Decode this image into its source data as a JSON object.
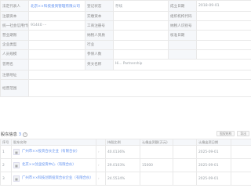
{
  "info_rows": [
    {
      "l1": "法定代表人",
      "v1": "北京××科技投资管理有限公司",
      "l2": "登记状态",
      "v2": "存续",
      "l3": "成立日期",
      "v3": "2018-09-01"
    },
    {
      "l1": "注册资本",
      "v1": "",
      "l2": "实缴资本",
      "v2": "",
      "l3": "组织机构代码",
      "v3": ""
    },
    {
      "l1": "统一社会信用代码",
      "v1": "91440 ···",
      "l2": "工商注册号",
      "v2": "",
      "l3": "纳税人识别号",
      "v3": ""
    },
    {
      "l1": "营业期限",
      "v1": "",
      "l2": "纳税人资质",
      "v2": "",
      "l3": "核准日期",
      "v3": ""
    },
    {
      "l1": "企业类型",
      "v1": "",
      "l2": "行业",
      "v2": "",
      "l3": "",
      "v3": ""
    },
    {
      "l1": "人员规模",
      "v1": "",
      "l2": "参保人数",
      "v2": "",
      "l3": "",
      "v3": ""
    },
    {
      "l1": "曾用名",
      "v1": "",
      "l2": "英文名称",
      "v2": "Hi... Partnership",
      "l3": "",
      "v3": ""
    },
    {
      "l1": "注册地址",
      "v1": "",
      "l2": "",
      "v2": "",
      "l3": "",
      "v3": ""
    },
    {
      "l1": "经营范围",
      "v1": "",
      "l2": "",
      "v2": "",
      "l3": "",
      "v3": ""
    }
  ],
  "shareholders_section": {
    "title": "股东信息",
    "count": "3",
    "tool1": "股权结构",
    "tool2": "导出"
  },
  "sh_headers": [
    "序号",
    "股东名称",
    "",
    "持股比例",
    "认缴出资额(万元)",
    "",
    "认缴出资日期",
    ""
  ],
  "shareholders": [
    {
      "idx": "1",
      "name": "广州市××投资合伙企业（有限合伙）",
      "tag": "",
      "ratio": "40.0136%",
      "amount": "",
      "date": "2025-09-01"
    },
    {
      "idx": "2",
      "name": "北京××创业投资中心（有限合伙）",
      "tag": "",
      "ratio": "29.0103%",
      "amount": "15000",
      "date": "2025-09-01"
    },
    {
      "idx": "3",
      "name": "广州市××科技创新投资合伙企业（有限合伙）",
      "tag": "",
      "ratio": "24.5534%",
      "amount": "",
      "date": "2025-09-01"
    }
  ]
}
